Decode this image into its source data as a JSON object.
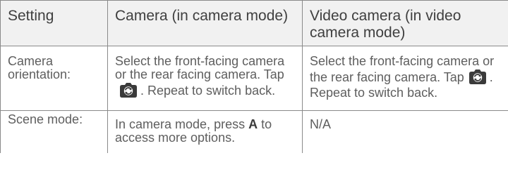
{
  "table": {
    "headers": {
      "setting": "Setting",
      "camera": "Camera (in camera mode)",
      "video": "Video camera (in video camera mode)"
    },
    "rows": [
      {
        "setting": "Camera orientation:",
        "camera": {
          "before_icon": "Select the front-facing camera or the rear facing camera. Tap",
          "icon": "camera-switch-icon",
          "after_icon": ". Repeat to switch back."
        },
        "video": {
          "before_icon": "Select the front-facing camera or the rear facing camera. Tap",
          "icon": "camera-switch-icon",
          "after_icon": ". Repeat to switch back."
        }
      },
      {
        "setting": "Scene mode:",
        "camera": {
          "before_key": "In camera mode, press",
          "key": "A",
          "after_key": "to access more options."
        },
        "video": "N/A"
      }
    ]
  },
  "colors": {
    "border": "#8a8a8a",
    "header_bg": "#f1f1f1",
    "text": "#5e5e5e",
    "icon": "#3a3a3a"
  }
}
